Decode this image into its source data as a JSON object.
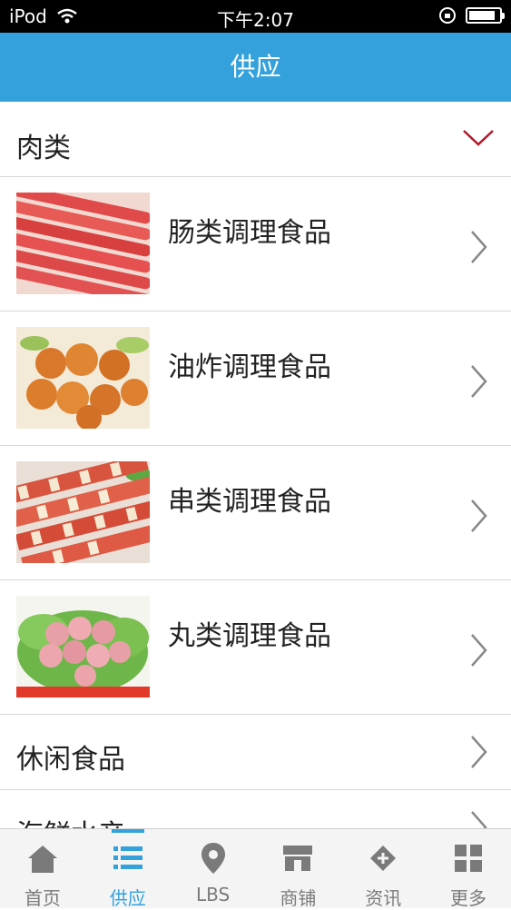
{
  "status_bar": {
    "device": "iPod",
    "time": "下午2:07"
  },
  "nav": {
    "title": "供应"
  },
  "category_expanded": {
    "label": "肉类"
  },
  "items": [
    {
      "title": "肠类调理食品"
    },
    {
      "title": "油炸调理食品"
    },
    {
      "title": "串类调理食品"
    },
    {
      "title": "丸类调理食品"
    }
  ],
  "categories": [
    {
      "label": "休闲食品"
    },
    {
      "label": "海鲜水产"
    }
  ],
  "tabs": [
    {
      "label": "首页",
      "icon": "home-icon"
    },
    {
      "label": "供应",
      "icon": "list-icon",
      "active": true
    },
    {
      "label": "LBS",
      "icon": "location-pin-icon"
    },
    {
      "label": "商铺",
      "icon": "store-icon"
    },
    {
      "label": "资讯",
      "icon": "news-icon"
    },
    {
      "label": "更多",
      "icon": "grid-icon"
    }
  ],
  "colors": {
    "accent": "#34a1dd",
    "chevron_down": "#b0182a",
    "chevron": "#888888"
  }
}
